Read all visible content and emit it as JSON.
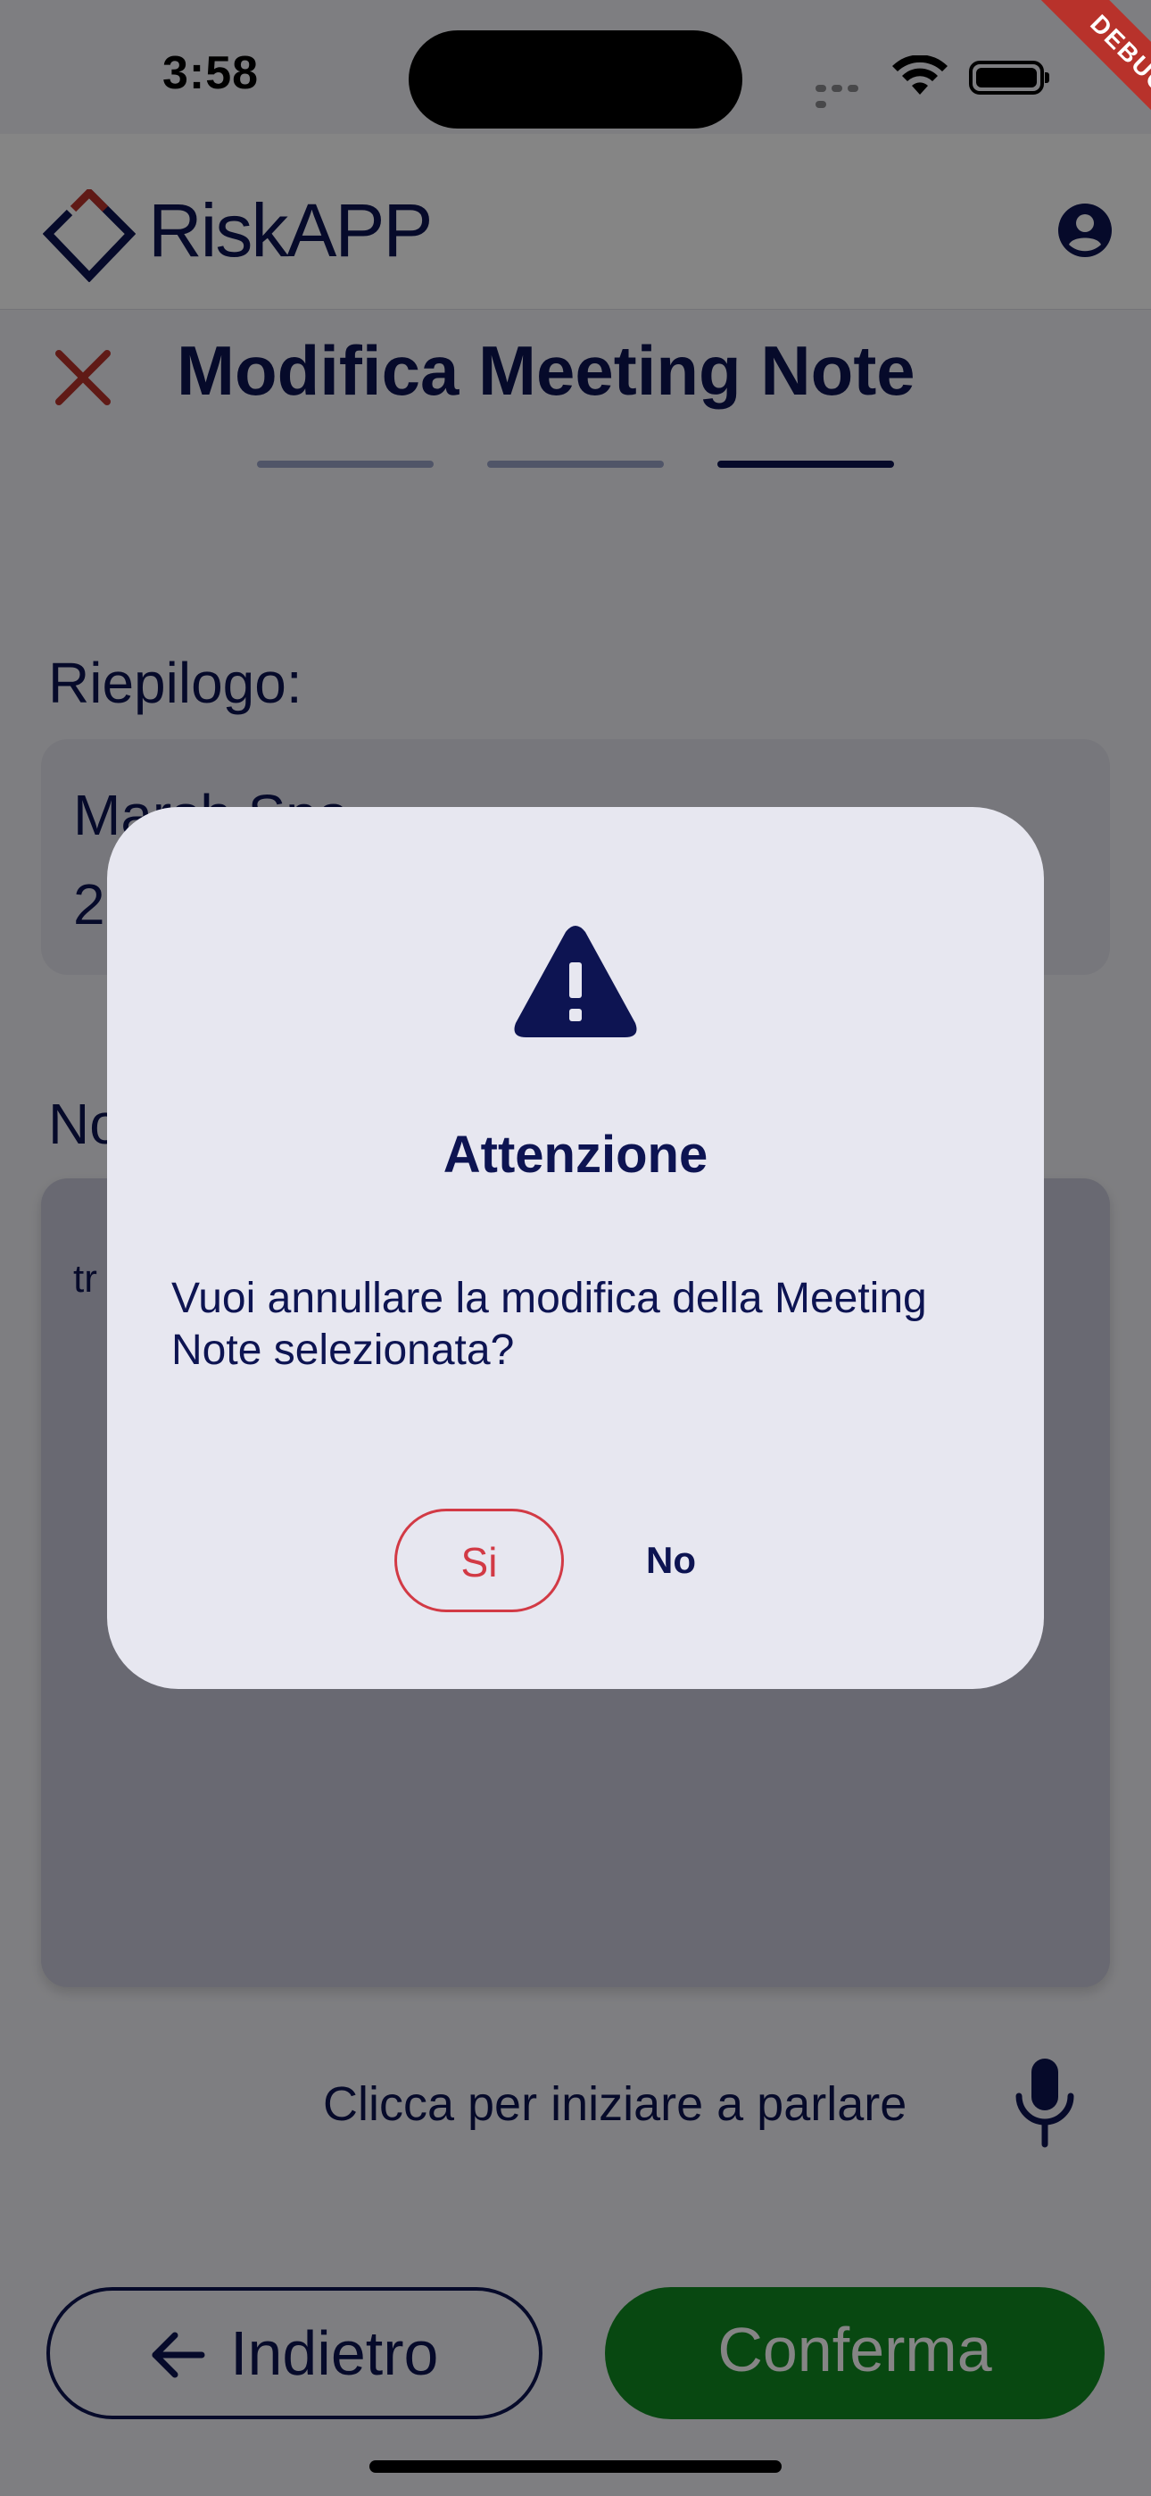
{
  "status_bar": {
    "time": "3:58",
    "debug_label": "DEBUG"
  },
  "app_bar": {
    "logo_text": "RiskAPP"
  },
  "header": {
    "title": "Modifica Meeting Note",
    "steps_total": 3,
    "steps_active": 3
  },
  "summary": {
    "label": "Riepilogo:",
    "lines": [
      "Marsh Spa",
      "2"
    ]
  },
  "note": {
    "label": "No",
    "text": "tr"
  },
  "speech": {
    "label": "Clicca per iniziare a parlare"
  },
  "footer": {
    "back_label": "Indietro",
    "confirm_label": "Conferma"
  },
  "dialog": {
    "title": "Attenzione",
    "message": "Vuoi annullare la modifica della Meeting Note selezionata?",
    "yes_label": "Si",
    "no_label": "No"
  },
  "colors": {
    "primary": "#0d1452",
    "danger": "#d23a45",
    "success": "#118a22"
  }
}
